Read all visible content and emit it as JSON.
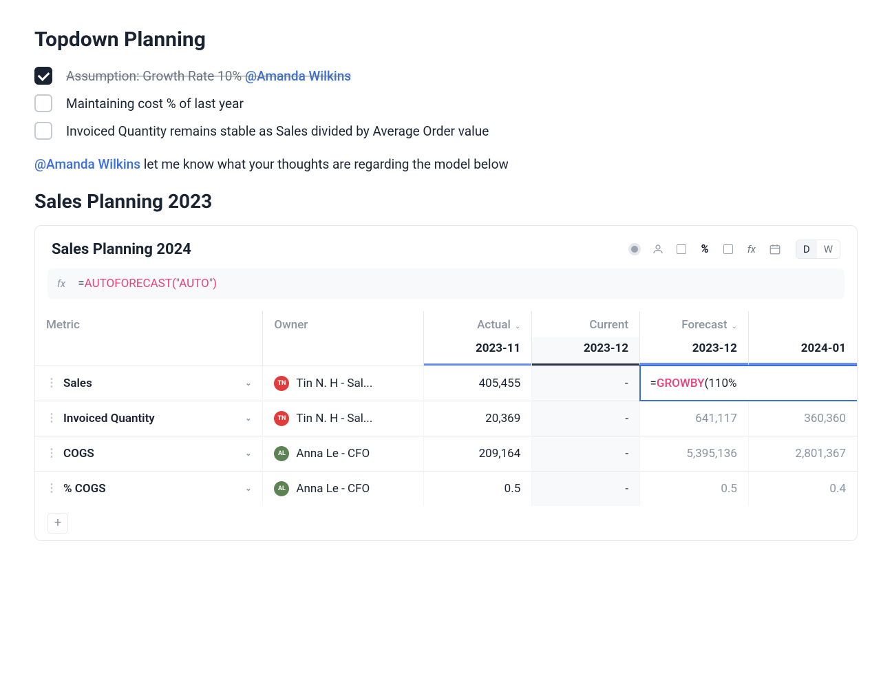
{
  "page_title": "Topdown Planning",
  "checklist": [
    {
      "checked": true,
      "text": "Assumption: Growth Rate 10% ",
      "mention": "@Amanda Wilkins",
      "strike": true
    },
    {
      "checked": false,
      "text": "Maintaining cost % of last year",
      "mention": "",
      "strike": false
    },
    {
      "checked": false,
      "text": "Invoiced Quantity remains stable as Sales divided by Average Order value",
      "mention": "",
      "strike": false
    }
  ],
  "note": {
    "mention": "@Amanda Wilkins",
    "text": " let me know what your thoughts are regarding the model below"
  },
  "section_title": "Sales Planning 2023",
  "card": {
    "title": "Sales Planning 2024",
    "formula_bar": {
      "fx": "fx",
      "eq": "=",
      "fn": "AUTOFORECAST",
      "arg": "\"AUTO\""
    },
    "toolbar": {
      "pct": "%",
      "fx": "fx",
      "d": "D",
      "w": "W"
    },
    "columns": {
      "metric": "Metric",
      "owner": "Owner",
      "groups": [
        {
          "label": "Actual",
          "has_chev": true
        },
        {
          "label": "Current",
          "has_chev": false
        },
        {
          "label": "Forecast",
          "has_chev": true
        }
      ],
      "periods": [
        "2023-11",
        "2023-12",
        "2023-12",
        "2024-01"
      ]
    },
    "rows": [
      {
        "metric": "Sales",
        "owner": {
          "name": "Tin N. H - Sal...",
          "initials": "TN",
          "color": "red"
        },
        "actual": "405,455",
        "current": "-",
        "forecast1": {
          "formula": true,
          "eq": "=",
          "fn": "GROWBY",
          "paren": "(",
          "arg": "110%"
        },
        "forecast2": ""
      },
      {
        "metric": "Invoiced Quantity",
        "owner": {
          "name": "Tin N. H - Sal...",
          "initials": "TN",
          "color": "red"
        },
        "actual": "20,369",
        "current": "-",
        "forecast1": "641,117",
        "forecast2": "360,360"
      },
      {
        "metric": "COGS",
        "owner": {
          "name": "Anna Le - CFO",
          "initials": "AL",
          "color": "green"
        },
        "actual": "209,164",
        "current": "-",
        "forecast1": "5,395,136",
        "forecast2": "2,801,367"
      },
      {
        "metric": "% COGS",
        "owner": {
          "name": "Anna Le - CFO",
          "initials": "AL",
          "color": "green"
        },
        "actual": "0.5",
        "current": "-",
        "forecast1": "0.5",
        "forecast2": "0.4"
      }
    ],
    "add_label": "+"
  }
}
